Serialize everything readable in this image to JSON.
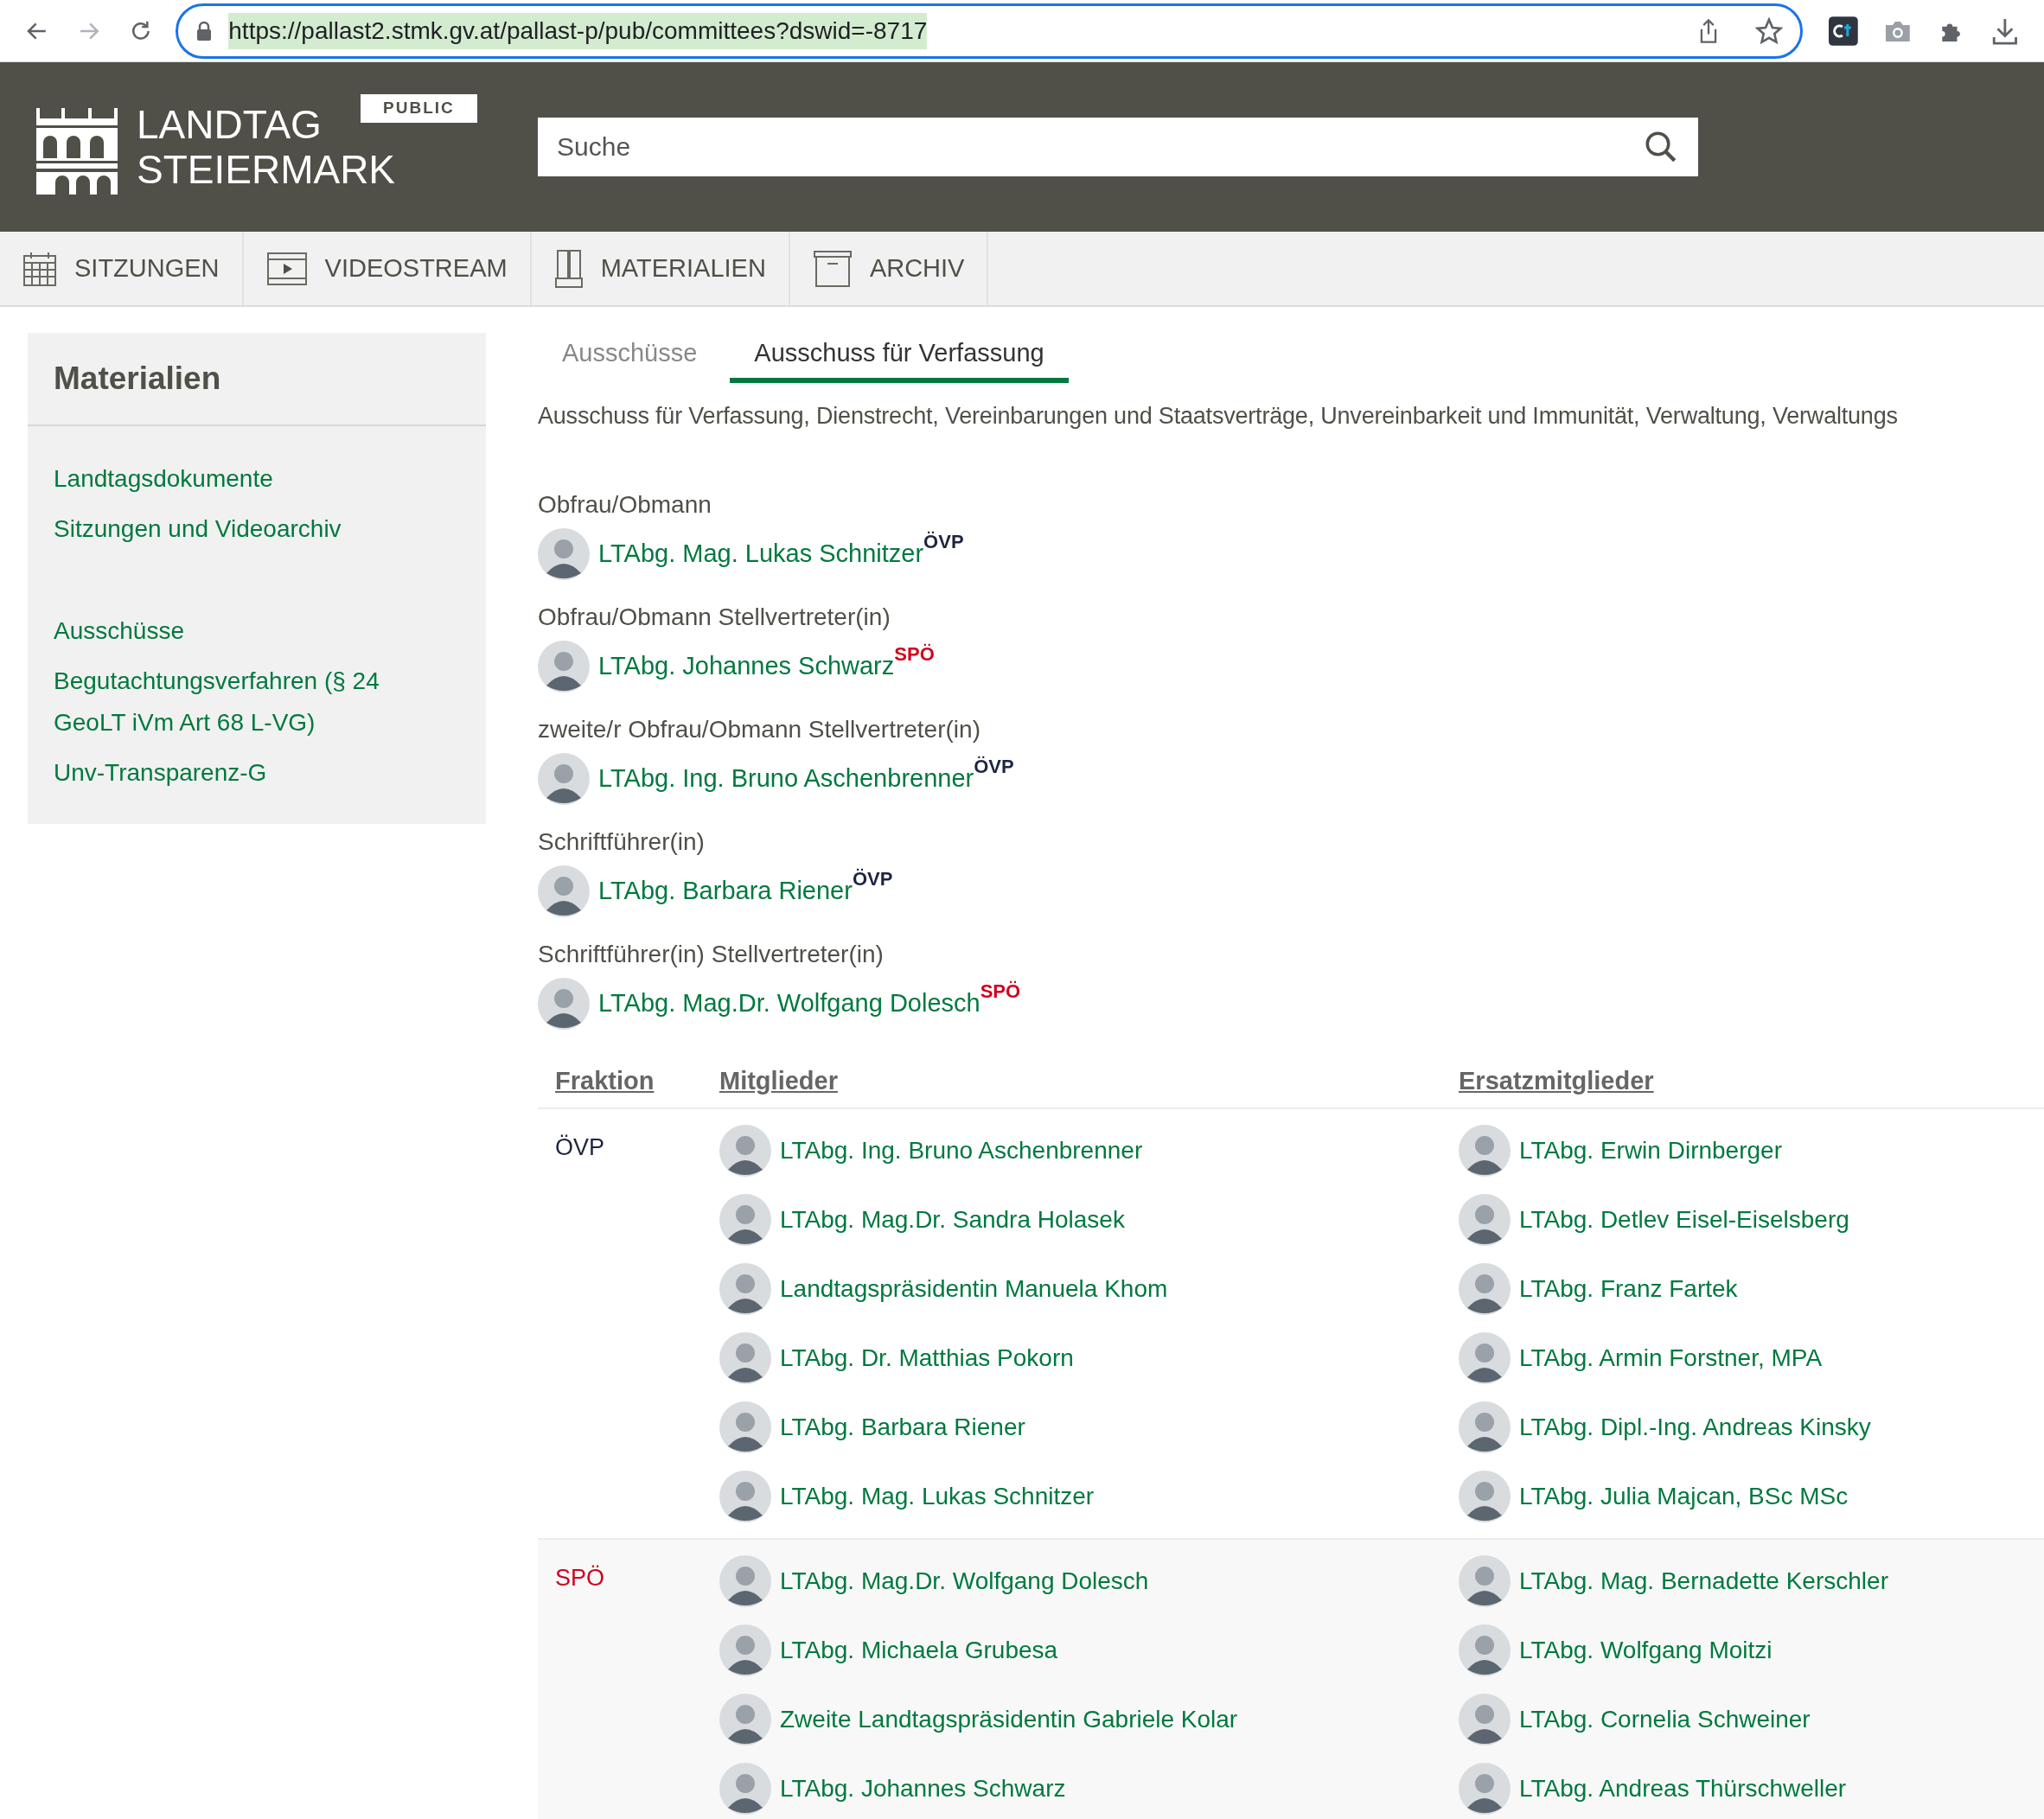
{
  "browser": {
    "url": "https://pallast2.stmk.gv.at/pallast-p/pub/committees?dswid=-8717"
  },
  "header": {
    "logo_lines": [
      "LANDTAG",
      "STEIERMARK"
    ],
    "badge": "PUBLIC",
    "search": {
      "placeholder": "Suche"
    }
  },
  "nav": [
    {
      "label": "SITZUNGEN",
      "kind": "calendar"
    },
    {
      "label": "VIDEOSTREAM",
      "kind": "film"
    },
    {
      "label": "MATERIALIEN",
      "kind": "cabinet"
    },
    {
      "label": "ARCHIV",
      "kind": "box"
    }
  ],
  "sidebar": {
    "title": "Materialien",
    "groups": [
      [
        "Landtagsdokumente",
        "Sitzungen und Videoarchiv"
      ],
      [
        "Ausschüsse",
        "Begutachtungsverfahren (§ 24 GeoLT iVm Art 68 L-VG)",
        "Unv-Transparenz-G"
      ]
    ]
  },
  "tabs": [
    {
      "label": "Ausschüsse",
      "selected": false
    },
    {
      "label": "Ausschuss für Verfassung",
      "selected": true
    }
  ],
  "description": "Ausschuss für Verfassung, Dienstrecht, Vereinbarungen und Staatsverträge, Unvereinbarkeit und Immunität, Verwaltung, Verwaltungs",
  "roles": [
    {
      "title": "Obfrau/Obmann",
      "name": "LTAbg. Mag. Lukas Schnitzer",
      "party": "ÖVP",
      "color": "#1c2541"
    },
    {
      "title": "Obfrau/Obmann Stellvertreter(in)",
      "name": "LTAbg. Johannes Schwarz",
      "party": "SPÖ",
      "color": "#d0021b"
    },
    {
      "title": "zweite/r Obfrau/Obmann Stellvertreter(in)",
      "name": "LTAbg. Ing. Bruno Aschenbrenner",
      "party": "ÖVP",
      "color": "#1c2541"
    },
    {
      "title": "Schriftführer(in)",
      "name": "LTAbg. Barbara Riener",
      "party": "ÖVP",
      "color": "#1c2541"
    },
    {
      "title": "Schriftführer(in) Stellvertreter(in)",
      "name": "LTAbg. Mag.Dr. Wolfgang Dolesch",
      "party": "SPÖ",
      "color": "#d0021b"
    }
  ],
  "table": {
    "columns": [
      "Fraktion",
      "Mitglieder",
      "Ersatzmitglieder"
    ],
    "groups": [
      {
        "party": "ÖVP",
        "color": "#1c2541",
        "members": [
          "LTAbg. Ing. Bruno Aschenbrenner",
          "LTAbg. Mag.Dr. Sandra Holasek",
          "Landtagspräsidentin Manuela Khom",
          "LTAbg. Dr. Matthias Pokorn",
          "LTAbg. Barbara Riener",
          "LTAbg. Mag. Lukas Schnitzer"
        ],
        "substitutes": [
          "LTAbg. Erwin Dirnberger",
          "LTAbg. Detlev Eisel-Eiselsberg",
          "LTAbg. Franz Fartek",
          "LTAbg. Armin Forstner, MPA",
          "LTAbg. Dipl.-Ing. Andreas Kinsky",
          "LTAbg. Julia Majcan, BSc MSc"
        ]
      },
      {
        "party": "SPÖ",
        "color": "#d0021b",
        "members": [
          "LTAbg. Mag.Dr. Wolfgang Dolesch",
          "LTAbg. Michaela Grubesa",
          "Zweite Landtagspräsidentin Gabriele Kolar",
          "LTAbg. Johannes Schwarz"
        ],
        "substitutes": [
          "LTAbg. Mag. Bernadette Kerschler",
          "LTAbg. Wolfgang Moitzi",
          "LTAbg. Cornelia Schweiner",
          "LTAbg. Andreas Thürschweller"
        ]
      }
    ]
  }
}
